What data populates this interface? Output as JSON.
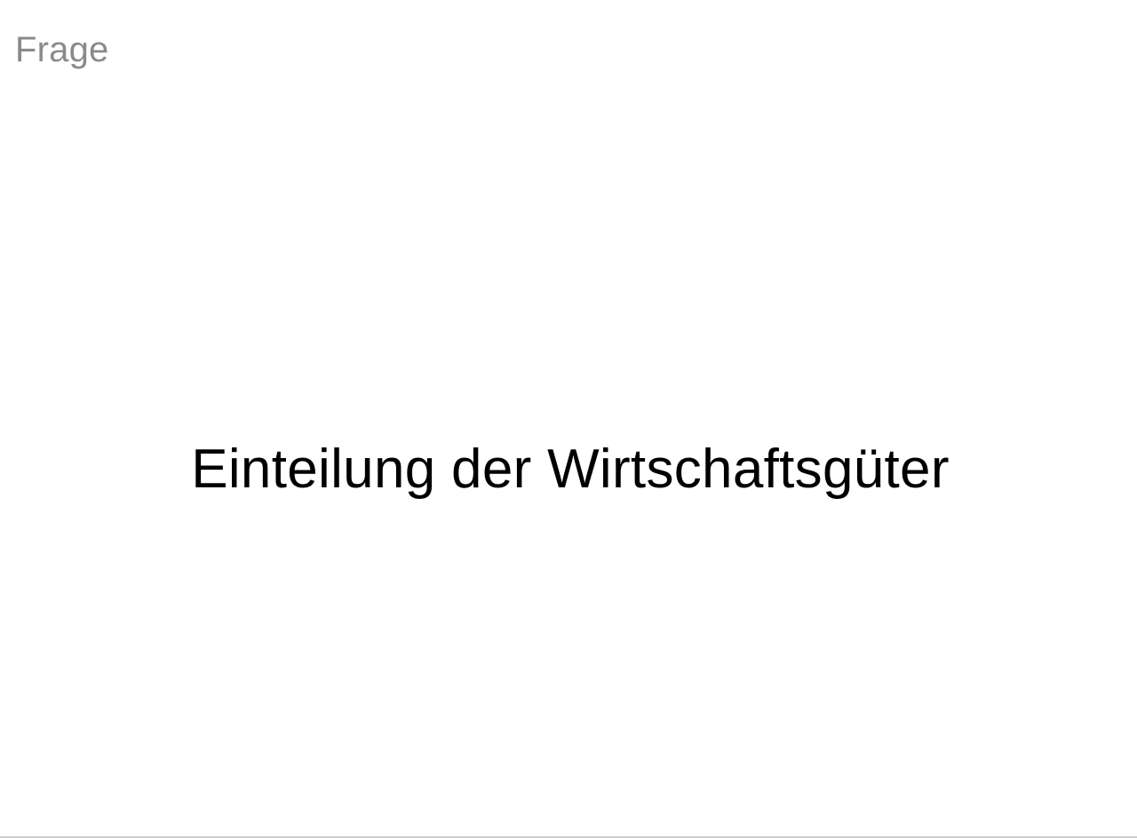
{
  "card": {
    "side_label": "Frage",
    "text": "Einteilung der Wirtschaftsgüter"
  },
  "colors": {
    "background": "#ffffff",
    "side_label": "#8a8a8e",
    "text": "#000000",
    "bottom_border": "#cfcfd2"
  }
}
